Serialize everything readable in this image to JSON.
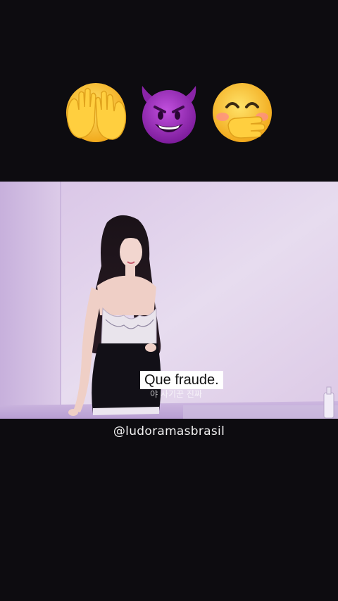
{
  "emojis": [
    {
      "icon": "face-with-open-eyes-and-hand-over-mouth-peeking-emoji",
      "description_symbol": "🫣"
    },
    {
      "icon": "smiling-face-with-horns-emoji",
      "description_symbol": "😈"
    },
    {
      "icon": "face-with-hand-over-mouth-emoji",
      "description_symbol": "🤭"
    }
  ],
  "video": {
    "caption": "Que fraude.",
    "korean_subtitle": "야 사기꾼 진짜"
  },
  "watermark": {
    "handle": "@ludoramasbrasil"
  },
  "colors": {
    "background": "#0d0c10",
    "scene_wall": "#e3d4ec",
    "scene_tint": "#c9b3e0",
    "emoji_yellow": "#f7c52a",
    "emoji_purple": "#9b2bb8"
  }
}
